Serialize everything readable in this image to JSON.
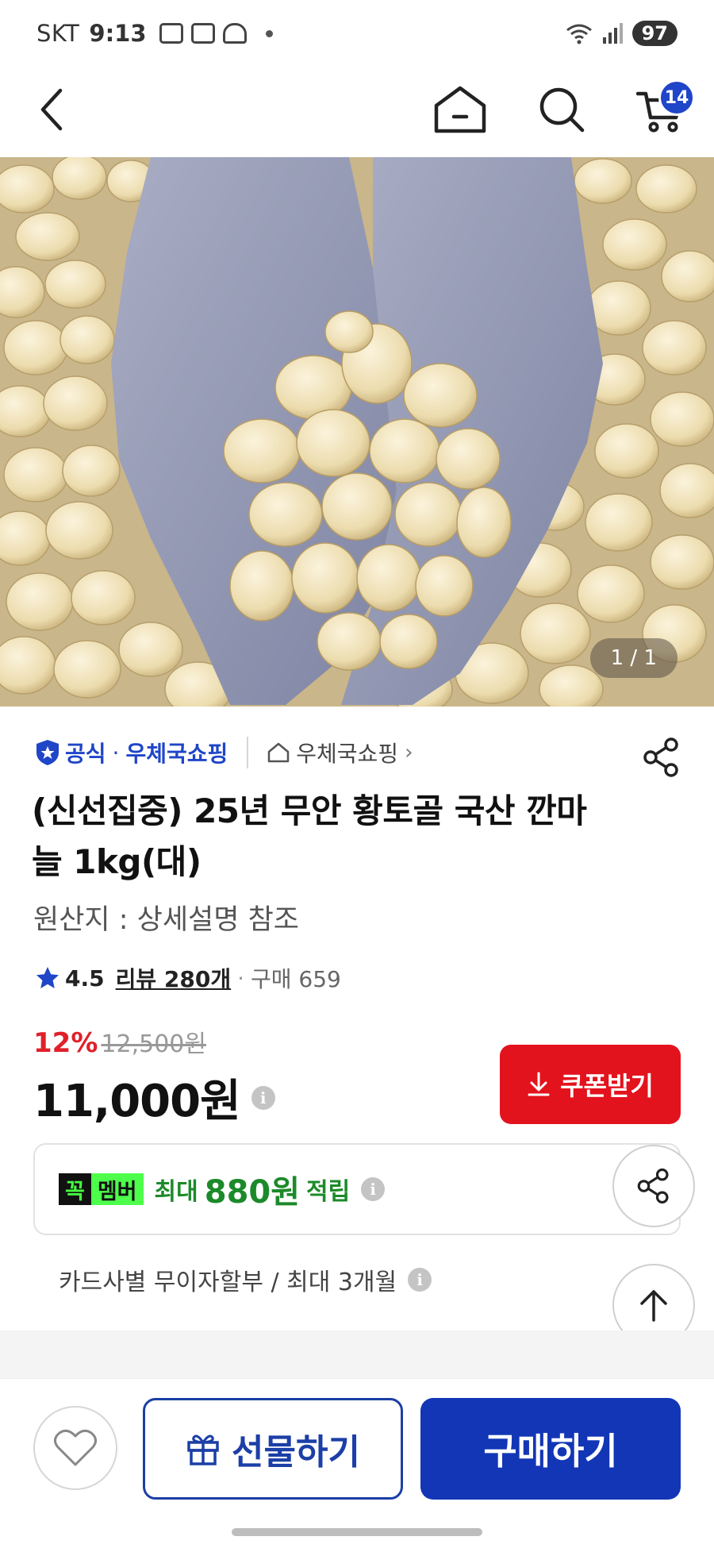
{
  "status_bar": {
    "carrier": "SKT",
    "time": "9:13",
    "battery": "97"
  },
  "header": {
    "cart_count": "14"
  },
  "gallery": {
    "counter": "1 / 1"
  },
  "product": {
    "official_label": "공식",
    "mall_name": "우체국쇼핑",
    "store_link": "우체국쇼핑",
    "title": "(신선집중) 25년 무안 황토골 국산 깐마늘 1kg(대)",
    "origin": "원산지 : 상세설명 참조",
    "rating": "4.5",
    "review_label": "리뷰 280개",
    "purchase_label": "구매 659",
    "discount_rate": "12%",
    "original_price": "12,500원",
    "price": "11,000원",
    "coupon_label": "쿠폰받기",
    "member_badge_k": "꼭",
    "member_badge_m": "멤버",
    "member_prefix": "최대",
    "member_amount": "880원",
    "member_suffix": "적립",
    "installment": "카드사별 무이자할부 / 최대 3개월"
  },
  "bottom_bar": {
    "gift_label": "선물하기",
    "buy_label": "구매하기"
  },
  "colors": {
    "brand_blue": "#1f45c8",
    "buy_button": "#1236b5",
    "coupon_red": "#e3131d",
    "discount_red": "#e0202a",
    "member_green": "#1c8a2a"
  }
}
